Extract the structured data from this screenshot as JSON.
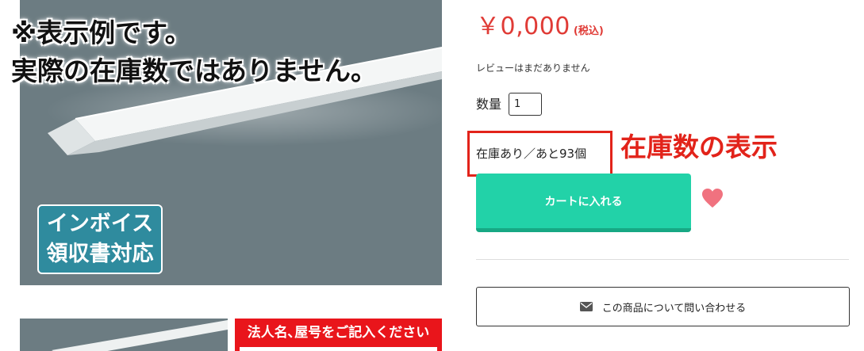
{
  "product_image": {
    "caption_lines": [
      "※表示例です。",
      "実際の在庫数ではありません。"
    ],
    "badge_lines": [
      "インボイス",
      "領収書対応"
    ]
  },
  "thumbnails": {
    "second_banner_text": "法人名､屋号をご記入ください"
  },
  "product": {
    "price": "￥0,000",
    "tax_note": "(税込)",
    "review_text": "レビューはまだありません",
    "quantity_label": "数量",
    "quantity_value": "1",
    "stock_text": "在庫あり／あと93個",
    "stock_annotation": "在庫数の表示",
    "cart_button_label": "カートに入れる",
    "contact_button_label": "この商品について問い合わせる"
  },
  "colors": {
    "price": "#e03b36",
    "cart_button": "#22d2a8",
    "heart": "#f0727f",
    "annotation_red": "#e2231a",
    "image_background": "#6c7c82"
  },
  "icons": {
    "favorite": "heart-icon",
    "contact": "envelope-icon"
  }
}
